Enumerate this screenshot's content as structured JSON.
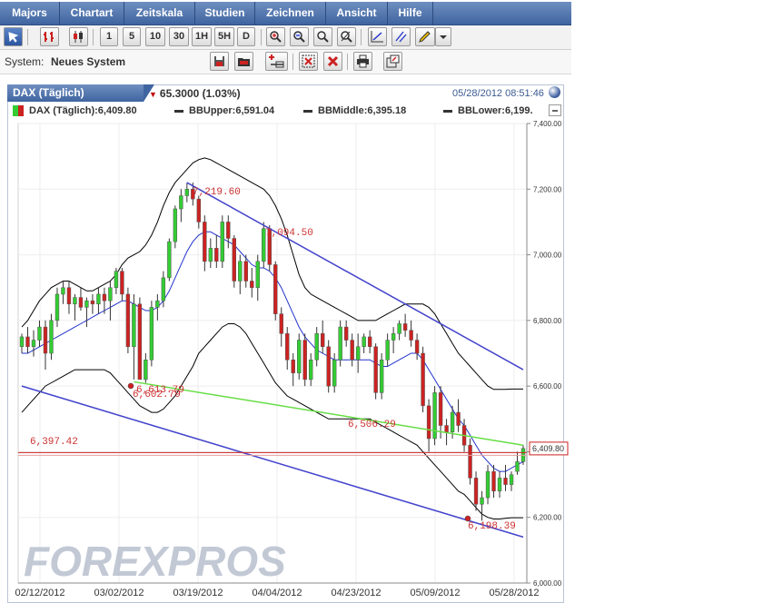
{
  "menu": [
    "Majors",
    "Chartart",
    "Zeitskala",
    "Studien",
    "Zeichnen",
    "Ansicht",
    "Hilfe"
  ],
  "toolbar": {
    "timeframes": [
      "1",
      "5",
      "10",
      "30",
      "1H",
      "5H",
      "D"
    ]
  },
  "system": {
    "label": "System:",
    "value": "Neues System"
  },
  "instrument": {
    "tab_label": "DAX (Täglich)",
    "change": "65.3000 (1.03%)",
    "datetime": "05/28/2012 08:51:46"
  },
  "legend": {
    "main": "DAX (Täglich):6,409.80",
    "upper": "BBUpper:6,591.04",
    "middle": "BBMiddle:6,395.18",
    "lower": "BBLower:6,199."
  },
  "watermark": "FOREXPROS",
  "colors": {
    "menu": "#4a6ea8",
    "up_candle": "#33cc33",
    "down_candle": "#cc2222",
    "bb_band": "#000000",
    "sma": "#2233cc",
    "trend_blue": "#4444cc",
    "trend_green": "#66dd44",
    "level_red": "#cc2222"
  },
  "chart_data": {
    "type": "candlestick",
    "ylim": [
      6000,
      7400
    ],
    "y_ticks": [
      "7,400.00",
      "7,200.00",
      "7,000.00",
      "6,800.00",
      "6,600.00",
      "6,400.00",
      "6,200.00",
      "6,000.00"
    ],
    "y_tick_values": [
      7400,
      7200,
      7000,
      6800,
      6600,
      6400,
      6200,
      6000
    ],
    "x_ticks": [
      "02/12/2012",
      "03/02/2012",
      "03/19/2012",
      "04/04/2012",
      "04/23/2012",
      "05/09/2012",
      "05/28/2012"
    ],
    "current_price_label": "6,409.80",
    "current_price": 6409.8,
    "annotations": [
      {
        "text": "7,219.60",
        "value": 7219.6
      },
      {
        "text": "7,094.50",
        "value": 7094.5
      },
      {
        "text": "6,613.79",
        "value": 6613.79
      },
      {
        "text": "6,602.79",
        "value": 6602.79
      },
      {
        "text": "6,506.29",
        "value": 6506.29
      },
      {
        "text": "6,397.42",
        "value": 6397.42
      },
      {
        "text": "6,198.39",
        "value": 6198.39
      }
    ],
    "candles": [
      [
        6720,
        6760,
        6700,
        6750
      ],
      [
        6750,
        6780,
        6700,
        6720
      ],
      [
        6720,
        6770,
        6690,
        6740
      ],
      [
        6740,
        6800,
        6720,
        6780
      ],
      [
        6780,
        6800,
        6650,
        6700
      ],
      [
        6700,
        6820,
        6680,
        6800
      ],
      [
        6800,
        6900,
        6780,
        6880
      ],
      [
        6880,
        6920,
        6850,
        6900
      ],
      [
        6900,
        6920,
        6820,
        6850
      ],
      [
        6850,
        6880,
        6800,
        6870
      ],
      [
        6870,
        6900,
        6830,
        6840
      ],
      [
        6840,
        6870,
        6780,
        6860
      ],
      [
        6860,
        6880,
        6820,
        6850
      ],
      [
        6850,
        6900,
        6820,
        6880
      ],
      [
        6880,
        6900,
        6820,
        6860
      ],
      [
        6860,
        6920,
        6800,
        6900
      ],
      [
        6900,
        6960,
        6880,
        6950
      ],
      [
        6950,
        6960,
        6860,
        6880
      ],
      [
        6880,
        6900,
        6700,
        6720
      ],
      [
        6720,
        6880,
        6620,
        6850
      ],
      [
        6850,
        6870,
        6640,
        6620
      ],
      [
        6620,
        6700,
        6610,
        6680
      ],
      [
        6680,
        6860,
        6660,
        6840
      ],
      [
        6840,
        6880,
        6800,
        6860
      ],
      [
        6860,
        6950,
        6840,
        6930
      ],
      [
        6930,
        7050,
        6920,
        7040
      ],
      [
        7040,
        7150,
        7020,
        7140
      ],
      [
        7140,
        7200,
        7100,
        7180
      ],
      [
        7180,
        7220,
        7160,
        7200
      ],
      [
        7200,
        7220,
        7150,
        7170
      ],
      [
        7170,
        7180,
        7080,
        7100
      ],
      [
        7100,
        7120,
        6950,
        6980
      ],
      [
        6980,
        7050,
        6960,
        7020
      ],
      [
        7020,
        7060,
        6960,
        6980
      ],
      [
        6980,
        7120,
        6960,
        7100
      ],
      [
        7100,
        7120,
        7020,
        7050
      ],
      [
        7050,
        7060,
        6900,
        6920
      ],
      [
        6920,
        7000,
        6880,
        6980
      ],
      [
        6980,
        7000,
        6900,
        6920
      ],
      [
        6920,
        6960,
        6870,
        6900
      ],
      [
        6900,
        7000,
        6860,
        6980
      ],
      [
        6980,
        7100,
        6960,
        7080
      ],
      [
        7080,
        7090,
        6950,
        6970
      ],
      [
        6970,
        6980,
        6800,
        6820
      ],
      [
        6820,
        6840,
        6720,
        6760
      ],
      [
        6760,
        6780,
        6650,
        6680
      ],
      [
        6680,
        6700,
        6600,
        6640
      ],
      [
        6640,
        6760,
        6620,
        6740
      ],
      [
        6740,
        6760,
        6600,
        6620
      ],
      [
        6620,
        6700,
        6600,
        6680
      ],
      [
        6680,
        6780,
        6660,
        6760
      ],
      [
        6760,
        6800,
        6700,
        6720
      ],
      [
        6720,
        6740,
        6580,
        6600
      ],
      [
        6600,
        6700,
        6580,
        6680
      ],
      [
        6680,
        6800,
        6660,
        6780
      ],
      [
        6780,
        6800,
        6720,
        6740
      ],
      [
        6740,
        6760,
        6660,
        6680
      ],
      [
        6680,
        6760,
        6640,
        6720
      ],
      [
        6720,
        6760,
        6700,
        6750
      ],
      [
        6750,
        6770,
        6700,
        6720
      ],
      [
        6720,
        6730,
        6560,
        6580
      ],
      [
        6580,
        6700,
        6560,
        6680
      ],
      [
        6680,
        6760,
        6660,
        6740
      ],
      [
        6740,
        6780,
        6700,
        6760
      ],
      [
        6760,
        6800,
        6740,
        6790
      ],
      [
        6790,
        6820,
        6750,
        6770
      ],
      [
        6770,
        6800,
        6720,
        6740
      ],
      [
        6740,
        6760,
        6680,
        6700
      ],
      [
        6700,
        6720,
        6520,
        6540
      ],
      [
        6540,
        6560,
        6400,
        6440
      ],
      [
        6440,
        6600,
        6420,
        6580
      ],
      [
        6580,
        6600,
        6440,
        6480
      ],
      [
        6480,
        6500,
        6420,
        6460
      ],
      [
        6460,
        6540,
        6440,
        6520
      ],
      [
        6520,
        6560,
        6460,
        6480
      ],
      [
        6480,
        6500,
        6400,
        6420
      ],
      [
        6420,
        6440,
        6300,
        6320
      ],
      [
        6320,
        6340,
        6220,
        6240
      ],
      [
        6240,
        6280,
        6190,
        6260
      ],
      [
        6260,
        6360,
        6240,
        6340
      ],
      [
        6340,
        6360,
        6260,
        6280
      ],
      [
        6280,
        6340,
        6260,
        6320
      ],
      [
        6320,
        6360,
        6280,
        6300
      ],
      [
        6300,
        6340,
        6280,
        6330
      ],
      [
        6340,
        6400,
        6330,
        6370
      ],
      [
        6370,
        6420,
        6360,
        6410
      ]
    ],
    "bb_upper": [
      6780,
      6800,
      6830,
      6860,
      6880,
      6900,
      6910,
      6920,
      6920,
      6910,
      6900,
      6890,
      6890,
      6900,
      6910,
      6920,
      6940,
      6970,
      6990,
      7000,
      7010,
      7030,
      7060,
      7100,
      7150,
      7190,
      7220,
      7240,
      7260,
      7280,
      7290,
      7295,
      7290,
      7280,
      7270,
      7260,
      7250,
      7240,
      7230,
      7220,
      7210,
      7200,
      7180,
      7150,
      7110,
      7060,
      7000,
      6940,
      6900,
      6880,
      6870,
      6860,
      6850,
      6840,
      6830,
      6820,
      6810,
      6800,
      6800,
      6800,
      6800,
      6810,
      6820,
      6830,
      6840,
      6850,
      6850,
      6850,
      6850,
      6840,
      6820,
      6790,
      6760,
      6730,
      6700,
      6680,
      6660,
      6640,
      6620,
      6600,
      6590,
      6590,
      6590,
      6591,
      6591,
      6591
    ],
    "bb_lower": [
      6520,
      6540,
      6560,
      6580,
      6600,
      6610,
      6620,
      6630,
      6640,
      6650,
      6650,
      6650,
      6650,
      6650,
      6650,
      6640,
      6620,
      6600,
      6580,
      6560,
      6540,
      6530,
      6520,
      6520,
      6530,
      6550,
      6570,
      6600,
      6630,
      6660,
      6700,
      6720,
      6740,
      6760,
      6780,
      6790,
      6790,
      6780,
      6760,
      6730,
      6700,
      6670,
      6640,
      6610,
      6590,
      6570,
      6560,
      6550,
      6540,
      6530,
      6520,
      6510,
      6500,
      6500,
      6500,
      6500,
      6500,
      6500,
      6500,
      6500,
      6490,
      6480,
      6470,
      6460,
      6450,
      6440,
      6430,
      6420,
      6400,
      6380,
      6360,
      6340,
      6320,
      6300,
      6280,
      6270,
      6250,
      6230,
      6210,
      6200,
      6195,
      6195,
      6197,
      6199,
      6199,
      6199
    ],
    "sma": [
      6700,
      6700,
      6710,
      6720,
      6730,
      6740,
      6750,
      6760,
      6770,
      6780,
      6790,
      6800,
      6810,
      6820,
      6830,
      6840,
      6850,
      6860,
      6860,
      6850,
      6840,
      6830,
      6830,
      6840,
      6860,
      6890,
      6930,
      6970,
      7010,
      7040,
      7060,
      7070,
      7070,
      7060,
      7050,
      7040,
      7030,
      7010,
      6990,
      6970,
      6960,
      6960,
      6950,
      6930,
      6900,
      6860,
      6820,
      6780,
      6750,
      6730,
      6710,
      6700,
      6690,
      6680,
      6680,
      6680,
      6680,
      6680,
      6680,
      6680,
      6670,
      6660,
      6660,
      6670,
      6680,
      6690,
      6700,
      6700,
      6680,
      6650,
      6620,
      6590,
      6560,
      6530,
      6500,
      6480,
      6450,
      6420,
      6390,
      6370,
      6350,
      6340,
      6340,
      6350,
      6360,
      6370
    ],
    "trendlines": [
      {
        "color": "blue",
        "from": {
          "x": 0,
          "y": 6600
        },
        "to": {
          "x": 85,
          "y": 6140
        }
      },
      {
        "color": "blue",
        "from": {
          "x": 28,
          "y": 7220
        },
        "to": {
          "x": 85,
          "y": 6650
        }
      },
      {
        "color": "green",
        "from": {
          "x": 19,
          "y": 6613
        },
        "to": {
          "x": 85,
          "y": 6420
        }
      }
    ],
    "horizontal_levels": [
      {
        "color": "red",
        "value": 6397.42
      }
    ]
  }
}
